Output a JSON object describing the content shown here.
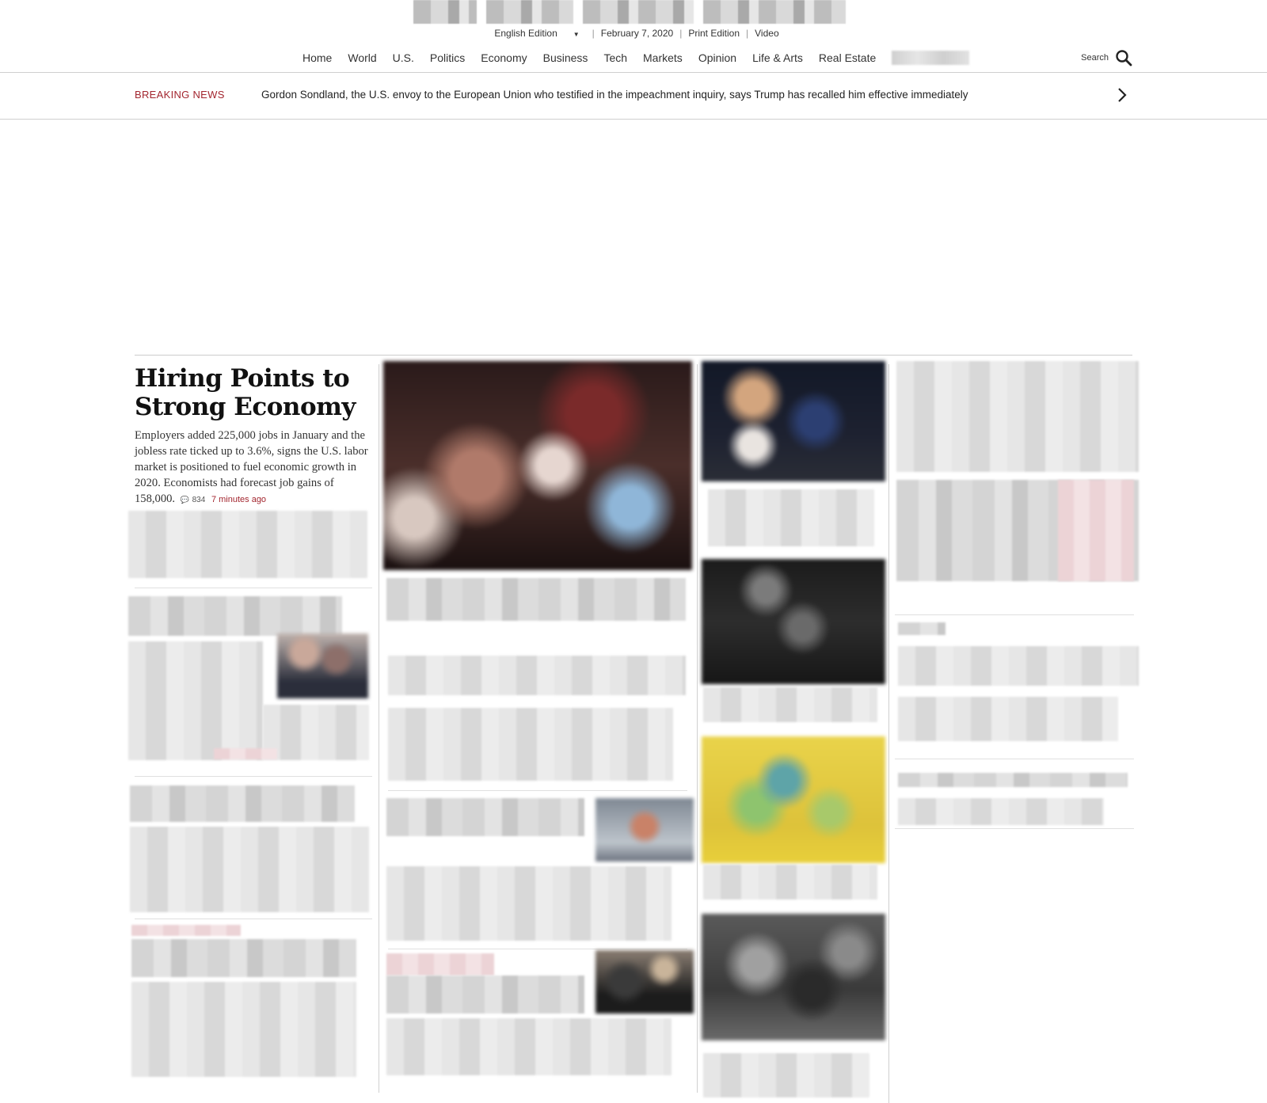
{
  "header": {
    "edition_label": "English Edition",
    "date": "February 7, 2020",
    "print_edition": "Print Edition",
    "video": "Video"
  },
  "nav": {
    "items": [
      "Home",
      "World",
      "U.S.",
      "Politics",
      "Economy",
      "Business",
      "Tech",
      "Markets",
      "Opinion",
      "Life & Arts",
      "Real Estate"
    ],
    "search_label": "Search"
  },
  "breaking": {
    "label": "BREAKING NEWS",
    "text": "Gordon Sondland, the U.S. envoy to the European Union who testified in the impeachment inquiry, says Trump has recalled him effective immediately"
  },
  "lead_story": {
    "headline": "Hiring Points to Strong Economy",
    "summary": "Employers added 225,000 jobs in January and the jobless rate ticked up to 3.6%, signs the U.S. labor market is positioned to fuel economic growth in 2020. Economists had forecast job gains of 158,000.",
    "comment_count": "834",
    "time_ago": "7 minutes ago"
  },
  "colors": {
    "accent_red": "#a3262f",
    "rule_gray": "#cfcfcf"
  },
  "icons": {
    "search": "search-icon",
    "next": "chevron-right-icon",
    "comment": "comment-icon",
    "caret": "caret-down-icon"
  }
}
